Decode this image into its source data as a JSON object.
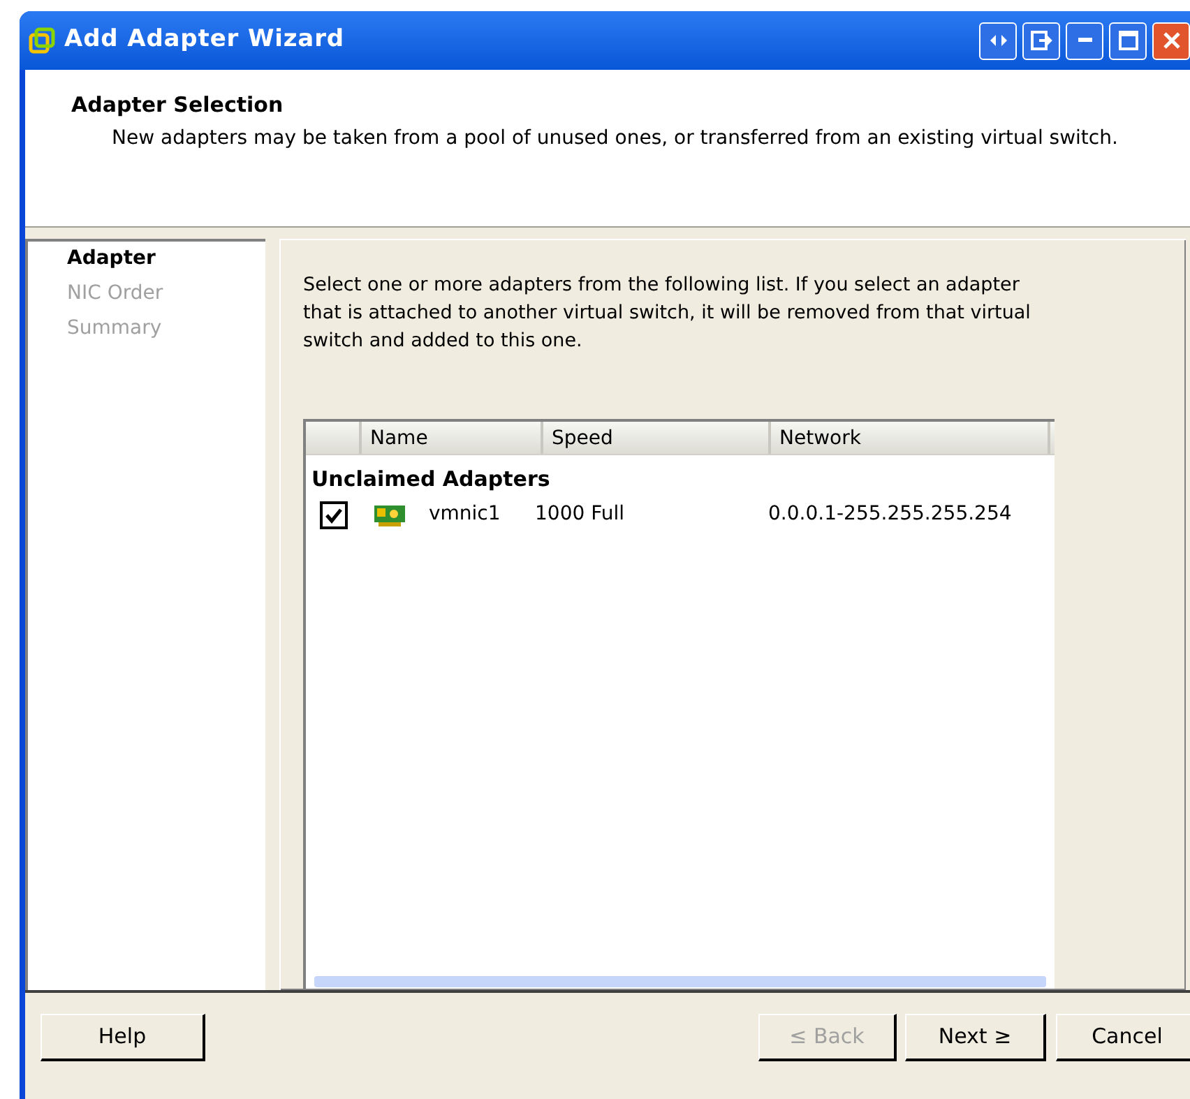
{
  "window": {
    "title": "Add Adapter Wizard"
  },
  "header": {
    "title": "Adapter Selection",
    "subtitle": "New adapters may be taken from a pool of unused ones, or transferred from an existing virtual switch."
  },
  "steps": [
    {
      "label": "Adapter",
      "selected": true
    },
    {
      "label": "NIC Order",
      "selected": false
    },
    {
      "label": "Summary",
      "selected": false
    }
  ],
  "instructions": "Select one or more adapters from the following list. If you select an adapter that is attached to another virtual switch, it will be removed from that virtual switch and added to this one.",
  "table": {
    "columns": [
      "Name",
      "Speed",
      "Network"
    ],
    "groups": [
      {
        "title": "Unclaimed Adapters",
        "rows": [
          {
            "checked": true,
            "name": "vmnic1",
            "speed": "1000 Full",
            "network": "0.0.0.1-255.255.255.254"
          }
        ]
      }
    ]
  },
  "buttons": [
    {
      "label": "Help",
      "disabled": false
    },
    {
      "label": "≤ Back",
      "disabled": true
    },
    {
      "label": "Next ≥",
      "disabled": false
    },
    {
      "label": "Cancel",
      "disabled": false
    }
  ]
}
